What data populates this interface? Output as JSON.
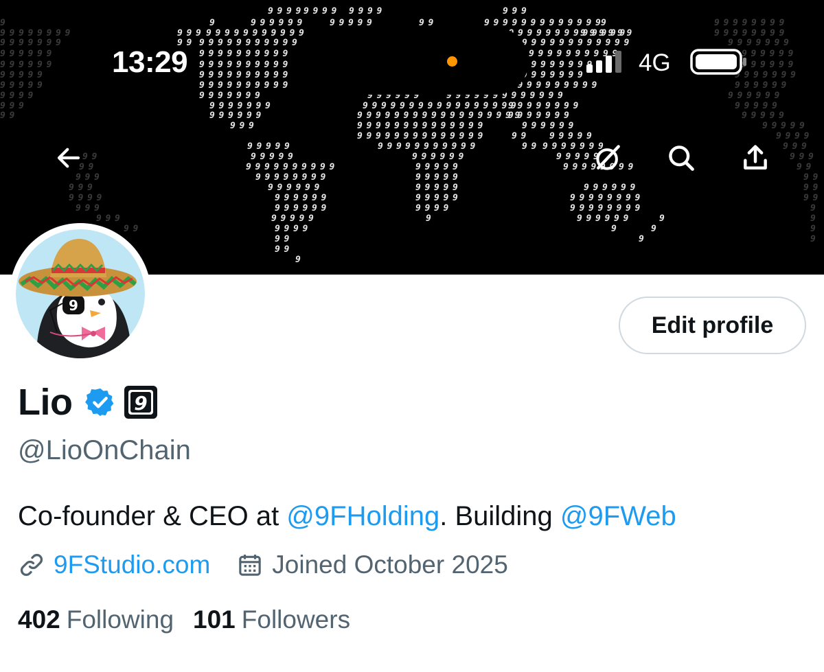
{
  "status_bar": {
    "time": "13:29",
    "network": "4G",
    "activity_dot_color": "#ff9500"
  },
  "banner": {
    "background_color": "#000000",
    "map_glyph": "9",
    "description_icon": "world-map-glyph-pattern"
  },
  "nav": {
    "back_icon": "arrow-left-icon",
    "grok_icon": "grok-icon",
    "search_icon": "search-icon",
    "share_icon": "share-icon"
  },
  "profile": {
    "display_name": "Lio",
    "handle": "@LioOnChain",
    "verified_badge_color": "#1d9bf0",
    "affiliate_glyph": "9",
    "edit_button_label": "Edit profile",
    "bio": {
      "part1": "Co-founder & CEO at ",
      "mention1": "@9FHolding",
      "part2": ". Building ",
      "mention2": "@9FWeb"
    },
    "website": "9FStudio.com",
    "joined": "Joined October 2025",
    "following_count": "402",
    "following_label": "Following",
    "followers_count": "101",
    "followers_label": "Followers"
  },
  "colors": {
    "accent": "#1d9bf0",
    "secondary_text": "#536471",
    "primary_text": "#0f1419",
    "button_border": "#cfd9de"
  }
}
